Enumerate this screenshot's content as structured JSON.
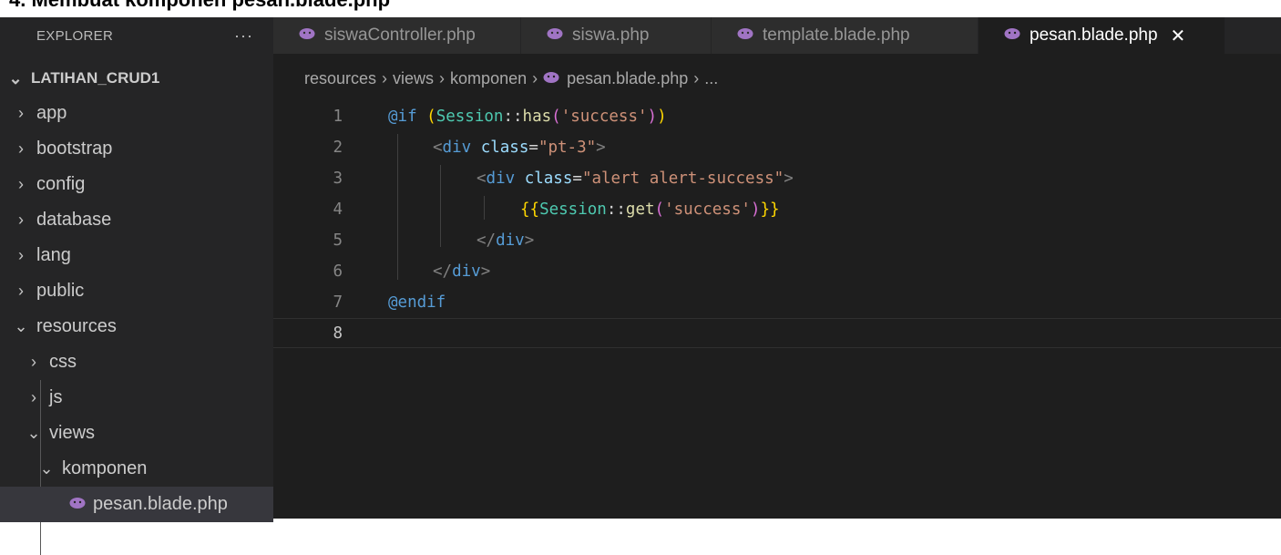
{
  "caption": "4. Membuat komponen pesan.blade.php",
  "sidebar": {
    "title": "EXPLORER",
    "more": "···",
    "project": "LATIHAN_CRUD1",
    "items": [
      {
        "label": "app",
        "chevron": "›"
      },
      {
        "label": "bootstrap",
        "chevron": "›"
      },
      {
        "label": "config",
        "chevron": "›"
      },
      {
        "label": "database",
        "chevron": "›"
      },
      {
        "label": "lang",
        "chevron": "›"
      },
      {
        "label": "public",
        "chevron": "›"
      },
      {
        "label": "resources",
        "chevron": "⌄"
      },
      {
        "label": "css",
        "chevron": "›"
      },
      {
        "label": "js",
        "chevron": "›"
      },
      {
        "label": "views",
        "chevron": "⌄"
      },
      {
        "label": "komponen",
        "chevron": "⌄"
      },
      {
        "label": "pesan.blade.php",
        "chevron": ""
      }
    ]
  },
  "tabs": [
    {
      "label": "siswaController.php",
      "icon": "php-elephant-icon"
    },
    {
      "label": "siswa.php",
      "icon": "php-elephant-icon"
    },
    {
      "label": "template.blade.php",
      "icon": "php-elephant-icon"
    },
    {
      "label": "pesan.blade.php",
      "icon": "php-elephant-icon",
      "active": true,
      "close": "✕"
    }
  ],
  "breadcrumb": [
    "resources",
    "views",
    "komponen",
    "pesan.blade.php",
    "..."
  ],
  "breadcrumb_separator": "›",
  "editor": {
    "line_numbers": [
      "1",
      "2",
      "3",
      "4",
      "5",
      "6",
      "7",
      "8"
    ],
    "current_line": "8",
    "code": {
      "l1": {
        "kw": "@if",
        "p1": " (",
        "cls": "Session",
        "op": "::",
        "fn": "has",
        "p2": "(",
        "str": "'success'",
        "p3": ")",
        "p4": ")"
      },
      "l2": {
        "lt": "<",
        "tag": "div",
        "attr": "class",
        "eq": "=",
        "val": "\"pt-3\"",
        "gt": ">"
      },
      "l3": {
        "lt": "<",
        "tag": "div",
        "attr": "class",
        "eq": "=",
        "val": "\"alert alert-success\"",
        "gt": ">"
      },
      "l4": {
        "open": "{{",
        "cls": "Session",
        "op": "::",
        "fn": "get",
        "p1": "(",
        "str": "'success'",
        "p2": ")",
        "close": "}}"
      },
      "l5": {
        "lt": "</",
        "tag": "div",
        "gt": ">"
      },
      "l6": {
        "lt": "</",
        "tag": "div",
        "gt": ">"
      },
      "l7": {
        "kw": "@endif"
      }
    }
  },
  "colors": {
    "background": "#1e1e1e",
    "sidebar": "#252526",
    "selected_row": "#37373d",
    "php_icon": "#a074c4"
  }
}
